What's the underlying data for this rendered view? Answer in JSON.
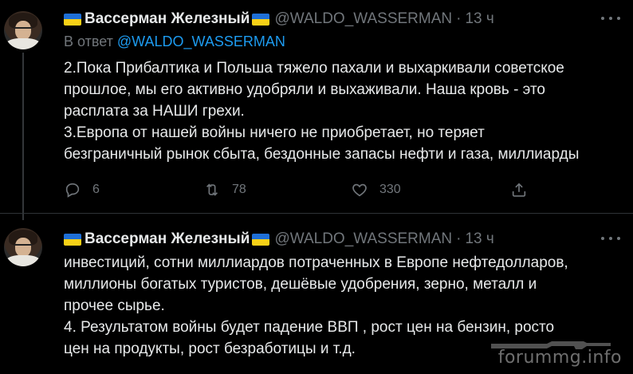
{
  "tweets": [
    {
      "name": "Вассерман Железный",
      "handle": "@WALDO_WASSERMAN",
      "separator": "·",
      "time": "13 ч",
      "reply_prefix": "В ответ",
      "reply_mention": "@WALDO_WASSERMAN",
      "lines": [
        "2.Пока Прибалтика и Польша тяжело пахали и выхаркивали советское",
        "прошлое, мы его активно удобряли и выхаживали. Наша кровь - это",
        "расплата за НАШИ грехи.",
        "3.Европа от нашей войны ничего не приобретает, но теряет",
        "безграничный рынок сбыта, бездонные запасы нефти и газа, миллиарды"
      ],
      "actions": {
        "replies": "6",
        "retweets": "78",
        "likes": "330"
      }
    },
    {
      "name": "Вассерман Железный",
      "handle": "@WALDO_WASSERMAN",
      "separator": "·",
      "time": "13 ч",
      "lines": [
        "инвестиций, сотни миллиардов потраченных в Европе нефтедолларов,",
        "миллионы богатых туристов, дешёвые удобрения, зерно, металл и",
        "прочее сырье.",
        "4. Результатом войны будет падение ВВП , рост цен на бензин, росто",
        "цен на продукты, рост безработицы и т.д."
      ]
    }
  ],
  "watermark": "forummg.info",
  "colors": {
    "background": "#000000",
    "text": "#e7e9ea",
    "muted": "#71767b",
    "link": "#1d9bf0",
    "flag_blue": "#1f6fd6",
    "flag_yellow": "#f7d117"
  }
}
